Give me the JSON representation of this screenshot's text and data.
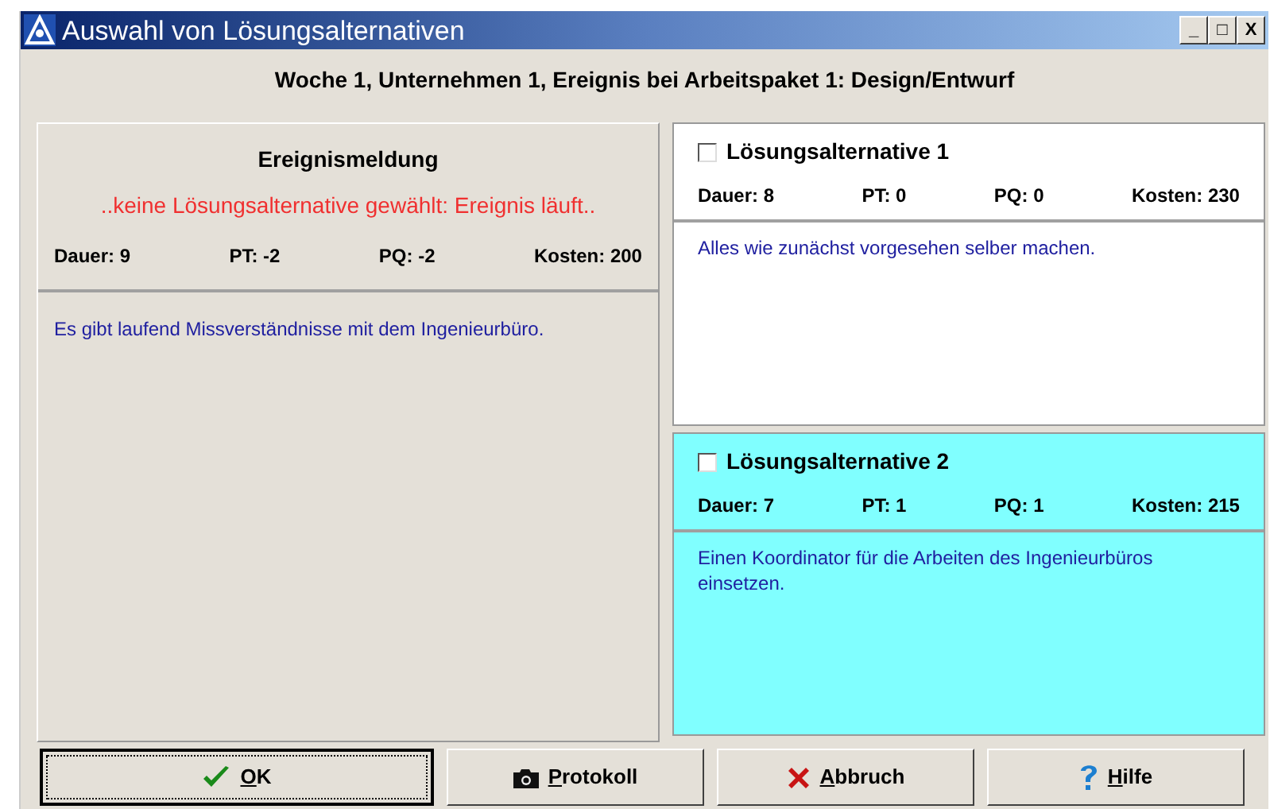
{
  "window": {
    "title": "Auswahl von Lösungsalternativen",
    "controls": [
      "_",
      "□",
      "X"
    ]
  },
  "heading": "Woche 1, Unternehmen 1, Ereignis bei Arbeitspaket 1: Design/Entwurf",
  "event": {
    "title": "Ereignismeldung",
    "status": "..keine Lösungsalternative gewählt: Ereignis läuft..",
    "stats": [
      "Dauer: 9",
      "PT: -2",
      "PQ: -2",
      "Kosten: 200"
    ],
    "description": "Es gibt laufend Missverständnisse mit dem Ingenieurbüro."
  },
  "alternatives": [
    {
      "title": "Lösungsalternative 1",
      "checked": false,
      "highlighted": false,
      "stats": [
        "Dauer: 8",
        "PT: 0",
        "PQ: 0",
        "Kosten: 230"
      ],
      "description": "Alles wie zunächst vorgesehen selber machen."
    },
    {
      "title": "Lösungsalternative 2",
      "checked": false,
      "highlighted": true,
      "stats": [
        "Dauer: 7",
        "PT: 1",
        "PQ: 1",
        "Kosten: 215"
      ],
      "description": "Einen Koordinator für die Arbeiten des Ingenieurbüros einsetzen."
    }
  ],
  "buttons": [
    {
      "label": "OK",
      "kind": "check",
      "default": true
    },
    {
      "label": "Protokoll",
      "kind": "camera",
      "default": false
    },
    {
      "label": "Abbruch",
      "kind": "cross",
      "default": false
    },
    {
      "label": "Hilfe",
      "kind": "question",
      "default": false
    }
  ]
}
